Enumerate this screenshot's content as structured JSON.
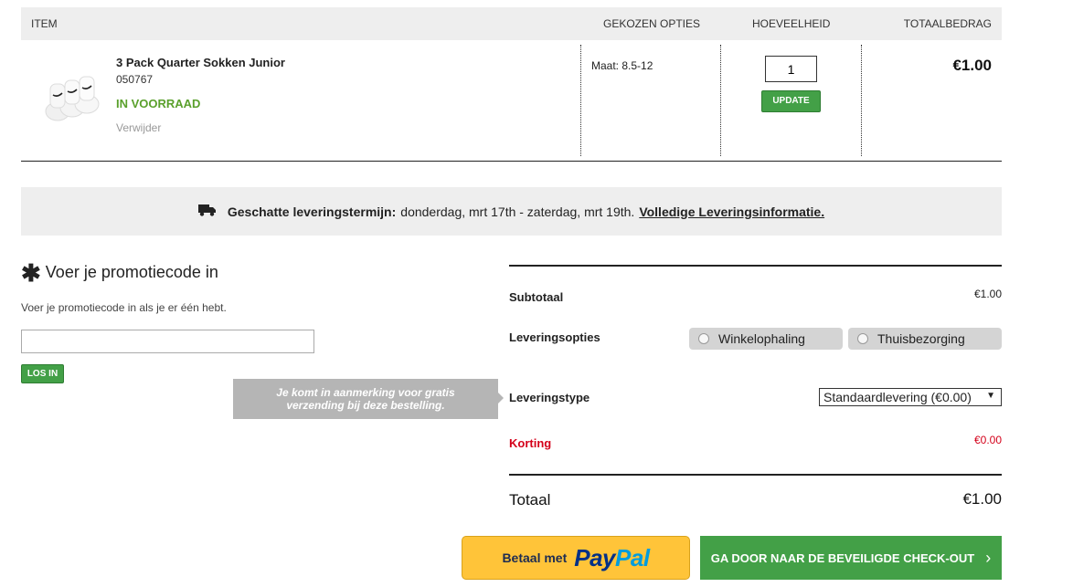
{
  "cart": {
    "headers": {
      "item": "ITEM",
      "options": "GEKOZEN OPTIES",
      "quantity": "HOEVEELHEID",
      "total": "TOTAALBEDRAG"
    },
    "item": {
      "name": "3 Pack Quarter Sokken Junior",
      "sku": "050767",
      "stock": "IN VOORRAAD",
      "remove": "Verwijder",
      "option": "Maat: 8.5-12",
      "quantity": "1",
      "update_label": "UPDATE",
      "line_total": "€1.00",
      "image_icon": "socks-product-image"
    }
  },
  "delivery": {
    "icon": "truck-icon",
    "label": "Geschatte leveringstermijn:",
    "range": "donderdag, mrt 17th - zaterdag, mrt 19th.",
    "link": "Volledige Leveringsinformatie."
  },
  "promo": {
    "title": "Voer je promotiecode in",
    "help": "Voer je promotiecode in als je er één hebt.",
    "input_value": "",
    "button": "LOS IN",
    "free_shipping": "Je komt in aanmerking voor gratis verzending bij deze bestelling."
  },
  "summary": {
    "subtotal_label": "Subtotaal",
    "subtotal_value": "€1.00",
    "delivery_options_label": "Leveringsopties",
    "option_store": "Winkelophaling",
    "option_home": "Thuisbezorging",
    "delivery_type_label": "Leveringstype",
    "delivery_type_value": "Standaardlevering (€0.00)",
    "discount_label": "Korting",
    "discount_value": "€0.00",
    "total_label": "Totaal",
    "total_value": "€1.00"
  },
  "buttons": {
    "paypal_prefix": "Betaal met",
    "paypal_brand_pay": "Pay",
    "paypal_brand_pal": "Pal",
    "checkout": "GA DOOR NAAR DE BEVEILIGDE CHECK-OUT",
    "checkout_chevron": "›"
  },
  "colors": {
    "green": "#43a047",
    "stock_green": "#5aa02c",
    "discount_red": "#d4001a",
    "paypal_yellow": "#ffc439"
  }
}
